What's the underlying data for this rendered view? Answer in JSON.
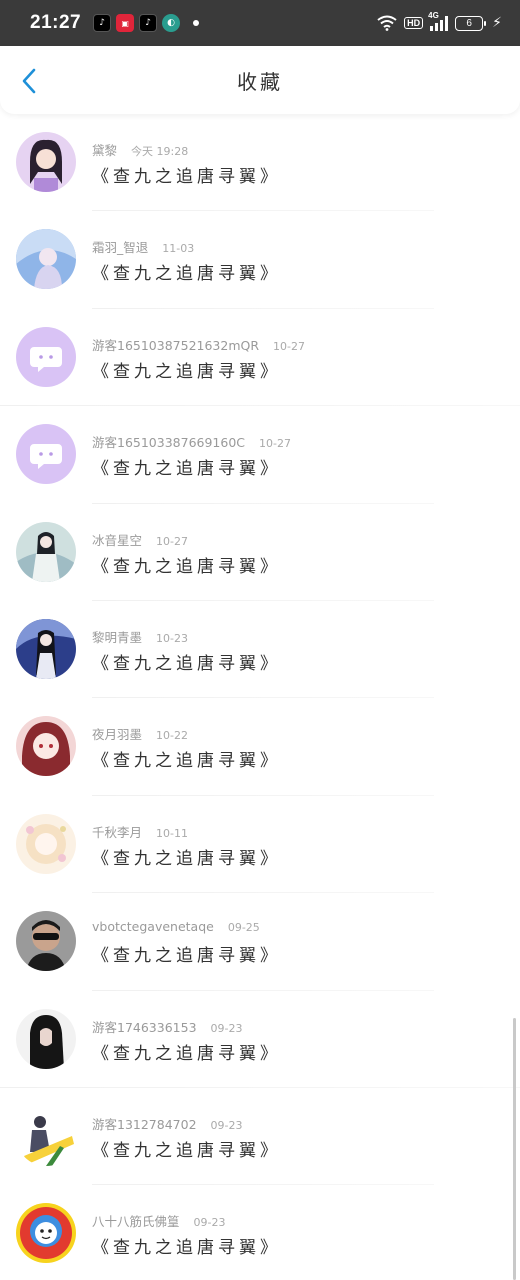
{
  "status_bar": {
    "time": "21:27",
    "notifications": [
      "tiktok-icon",
      "app-icon",
      "tiktok-icon",
      "app-icon"
    ],
    "hd": "HD",
    "network": "4G",
    "battery": "6"
  },
  "header": {
    "title": "收藏"
  },
  "items": [
    {
      "name": "黛黎",
      "date": "今天 19:28",
      "book": "《查九之追唐寻翼》"
    },
    {
      "name": "霜羽_智退",
      "date": "11-03",
      "book": "《查九之追唐寻翼》"
    },
    {
      "name": "游客16510387521632mQR",
      "date": "10-27",
      "book": "《查九之追唐寻翼》"
    },
    {
      "name": "游客1651033876691​60C",
      "date": "10-27",
      "book": "《查九之追唐寻翼》"
    },
    {
      "name": "冰音星空",
      "date": "10-27",
      "book": "《查九之追唐寻翼》"
    },
    {
      "name": "黎明青墨",
      "date": "10-23",
      "book": "《查九之追唐寻翼》"
    },
    {
      "name": "夜月羽墨",
      "date": "10-22",
      "book": "《查九之追唐寻翼》"
    },
    {
      "name": "千秋李月",
      "date": "10-11",
      "book": "《查九之追唐寻翼》"
    },
    {
      "name": "vbotctegavenetaqe",
      "date": "09-25",
      "book": "《查九之追唐寻翼》"
    },
    {
      "name": "游客1746336153",
      "date": "09-23",
      "book": "《查九之追唐寻翼》"
    },
    {
      "name": "游客1312784702",
      "date": "09-23",
      "book": "《查九之追唐寻翼》"
    },
    {
      "name": "八十八筋氏佛篁",
      "date": "09-23",
      "book": "《查九之追唐寻翼》"
    }
  ],
  "colors": {
    "accent": "#1e90d8",
    "default_avatar": "#d9c3f5"
  }
}
